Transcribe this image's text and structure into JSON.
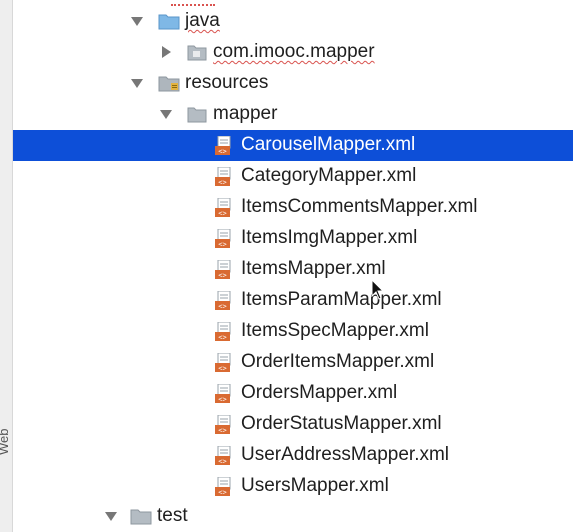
{
  "side_strip": {
    "label": "Web"
  },
  "tree": {
    "java": {
      "label": "java"
    },
    "package": {
      "label": "com.imooc.mapper"
    },
    "resources": {
      "label": "resources"
    },
    "mapper": {
      "label": "mapper"
    },
    "files": [
      {
        "label": "CarouselMapper.xml",
        "selected": true
      },
      {
        "label": "CategoryMapper.xml"
      },
      {
        "label": "ItemsCommentsMapper.xml"
      },
      {
        "label": "ItemsImgMapper.xml"
      },
      {
        "label": "ItemsMapper.xml"
      },
      {
        "label": "ItemsParamMapper.xml"
      },
      {
        "label": "ItemsSpecMapper.xml"
      },
      {
        "label": "OrderItemsMapper.xml"
      },
      {
        "label": "OrdersMapper.xml"
      },
      {
        "label": "OrderStatusMapper.xml"
      },
      {
        "label": "UserAddressMapper.xml"
      },
      {
        "label": "UsersMapper.xml"
      }
    ],
    "test": {
      "label": "test"
    }
  },
  "colors": {
    "selection": "#0d4fd8",
    "folder_blue": "#7fb8e6",
    "folder_gray": "#9aa3ab",
    "xml_orange": "#d96a32"
  },
  "icons": {
    "expanded": "triangle-down",
    "collapsed": "triangle-right",
    "source_folder": "folder-blue-icon",
    "package": "package-icon",
    "resources_folder": "resources-folder-icon",
    "folder": "folder-icon",
    "file": "xml-file-icon"
  }
}
